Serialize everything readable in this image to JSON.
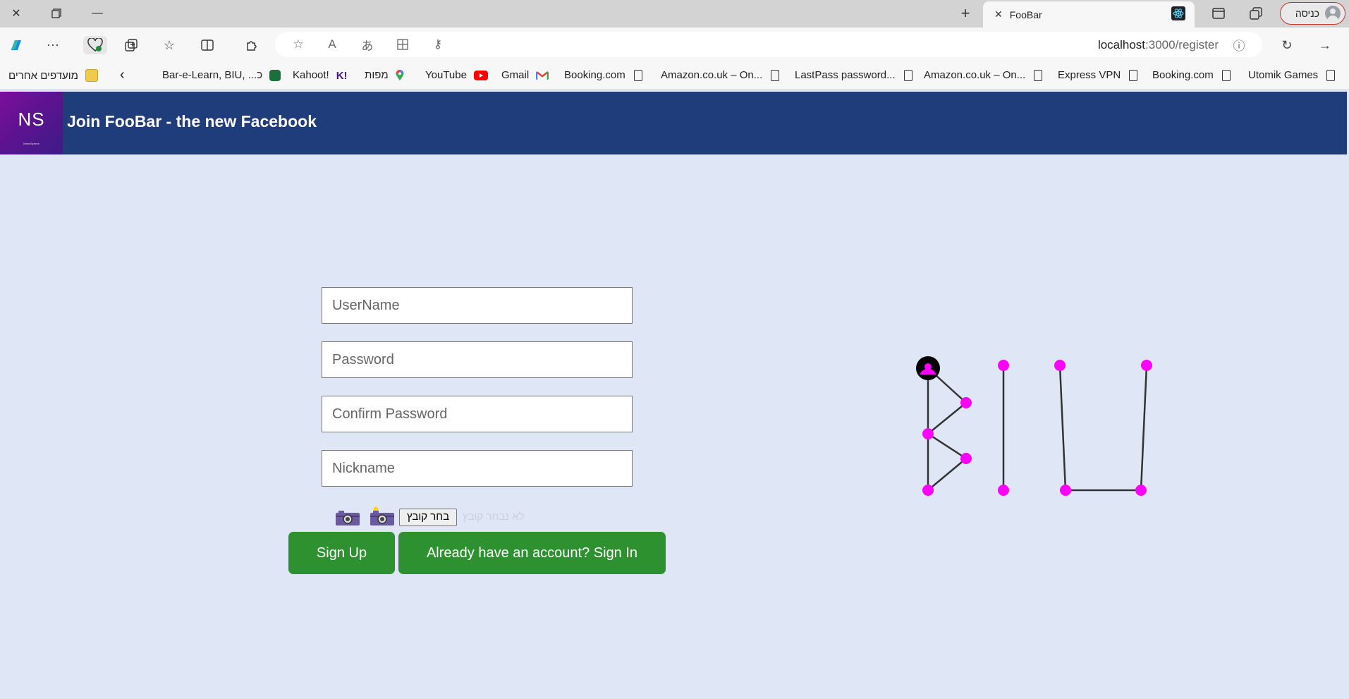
{
  "browser": {
    "tab_title": "FooBar",
    "profile_label": "כניסה",
    "url_host": "localhost",
    "url_path": ":3000/register"
  },
  "bookmarks": [
    {
      "label": "מועדפים אחרים",
      "icon": "folder-icon"
    },
    {
      "label": "Bar-e-Learn, BIU, ...כ",
      "icon": "moodle-icon"
    },
    {
      "label": "Kahoot!",
      "icon": "kahoot-icon"
    },
    {
      "label": "מפות",
      "icon": "maps-icon"
    },
    {
      "label": "YouTube",
      "icon": "youtube-icon"
    },
    {
      "label": "Gmail",
      "icon": "gmail-icon"
    },
    {
      "label": "Booking.com",
      "icon": "page-icon"
    },
    {
      "label": "Amazon.co.uk – On...",
      "icon": "page-icon"
    },
    {
      "label": "LastPass password...",
      "icon": "page-icon"
    },
    {
      "label": "Amazon.co.uk – On...",
      "icon": "page-icon"
    },
    {
      "label": "Express VPN",
      "icon": "page-icon"
    },
    {
      "label": "Booking.com",
      "icon": "page-icon"
    },
    {
      "label": "Utomik Games",
      "icon": "page-icon"
    }
  ],
  "app": {
    "logo_text": "NS",
    "logo_subtext": "NewsSphere",
    "title": "Join FooBar - the new Facebook"
  },
  "form": {
    "username_placeholder": "UserName",
    "password_placeholder": "Password",
    "confirm_placeholder": "Confirm Password",
    "nickname_placeholder": "Nickname",
    "file_button": "בחר קובץ",
    "no_file_text": "לא נבחר קובץ",
    "signup_label": "Sign Up",
    "signin_label": "Already have an account? Sign In"
  },
  "colors": {
    "header_bg": "#1f3c7b",
    "page_bg": "#dfe7f6",
    "button_green": "#2e912f",
    "graph_node": "#ff00ff"
  }
}
